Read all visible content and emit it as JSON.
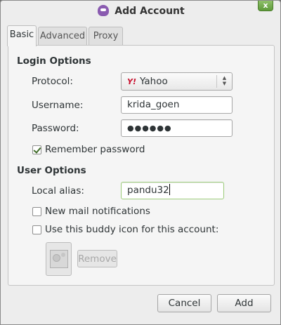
{
  "window": {
    "title": "Add Account",
    "close_label": "x"
  },
  "tabs": [
    {
      "label": "Basic"
    },
    {
      "label": "Advanced"
    },
    {
      "label": "Proxy"
    }
  ],
  "login": {
    "heading": "Login Options",
    "protocol_label": "Protocol:",
    "protocol_value": "Yahoo",
    "protocol_logo": "Y!",
    "username_label": "Username:",
    "username_value": "krida_goen",
    "password_label": "Password:",
    "password_value": "●●●●●●",
    "remember_label": "Remember password",
    "remember_checked": true
  },
  "user": {
    "heading": "User Options",
    "alias_label": "Local alias:",
    "alias_value": "pandu32",
    "mail_label": "New mail notifications",
    "mail_checked": false,
    "buddy_label": "Use this buddy icon for this account:",
    "buddy_checked": false,
    "remove_label": "Remove"
  },
  "footer": {
    "cancel_label": "Cancel",
    "add_label": "Add"
  }
}
